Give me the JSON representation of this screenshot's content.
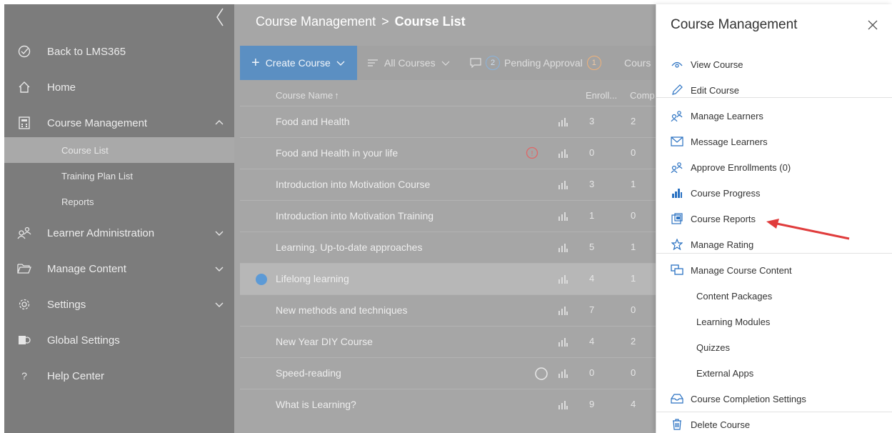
{
  "sidebar": {
    "items": [
      {
        "label": "Back to LMS365",
        "icon": "check-circle-icon"
      },
      {
        "label": "Home",
        "icon": "home-icon"
      },
      {
        "label": "Course Management",
        "icon": "calculator-icon"
      },
      {
        "label": "Learner Administration",
        "icon": "learners-icon"
      },
      {
        "label": "Manage Content",
        "icon": "folder-icon"
      },
      {
        "label": "Settings",
        "icon": "gear-icon"
      },
      {
        "label": "Global Settings",
        "icon": "global-settings-icon"
      },
      {
        "label": "Help Center",
        "icon": "help-icon"
      }
    ],
    "sub_items": [
      "Course List",
      "Training Plan List",
      "Reports"
    ],
    "help_glyph": "?"
  },
  "main": {
    "breadcrumb": {
      "parent": "Course Management",
      "separator": ">",
      "current": "Course List"
    },
    "toolbar": {
      "create_label": "Create Course",
      "plus": "+",
      "filter_label": "All Courses",
      "comment_count": "2",
      "pending_label": "Pending Approval",
      "pending_count": "1",
      "courses_label": "Cours"
    },
    "columns": {
      "name": "Course Name",
      "sort": "↑",
      "enrolled": "Enroll...",
      "completed": "Comp"
    },
    "rows": [
      {
        "name": "Food and Health",
        "enrolled": "3",
        "completed": "2"
      },
      {
        "name": "Food and Health in your life",
        "enrolled": "0",
        "completed": "0",
        "warning": "!"
      },
      {
        "name": "Introduction into Motivation Course",
        "enrolled": "3",
        "completed": "1"
      },
      {
        "name": "Introduction into Motivation Training",
        "enrolled": "1",
        "completed": "0"
      },
      {
        "name": "Learning. Up-to-date approaches",
        "enrolled": "5",
        "completed": "1"
      },
      {
        "name": "Lifelong learning",
        "enrolled": "4",
        "completed": "1"
      },
      {
        "name": "New methods and techniques",
        "enrolled": "7",
        "completed": "0"
      },
      {
        "name": "New Year DIY Course",
        "enrolled": "4",
        "completed": "2"
      },
      {
        "name": "Speed-reading",
        "enrolled": "0",
        "completed": "0"
      },
      {
        "name": "What is Learning?",
        "enrolled": "9",
        "completed": "4"
      }
    ]
  },
  "panel": {
    "title": "Course Management",
    "items": [
      {
        "label": "View Course",
        "icon": "eye-icon"
      },
      {
        "label": "Edit Course",
        "icon": "pencil-icon"
      },
      {
        "label": "Manage Learners",
        "icon": "learners-icon"
      },
      {
        "label": "Message Learners",
        "icon": "mail-icon"
      },
      {
        "label": "Approve Enrollments (0)",
        "icon": "learners-icon"
      },
      {
        "label": "Course Progress",
        "icon": "bar-chart-icon"
      },
      {
        "label": "Course Reports",
        "icon": "report-icon"
      },
      {
        "label": "Manage Rating",
        "icon": "star-icon"
      },
      {
        "label": "Manage Course Content",
        "icon": "content-icon"
      },
      {
        "label": "Content Packages"
      },
      {
        "label": "Learning Modules"
      },
      {
        "label": "Quizzes"
      },
      {
        "label": "External Apps"
      },
      {
        "label": "Course Completion Settings",
        "icon": "inbox-icon"
      },
      {
        "label": "Delete Course",
        "icon": "trash-icon"
      }
    ]
  },
  "colors": {
    "accent": "#5b8fc2",
    "badge": "#f0b27a",
    "warning": "#e06666",
    "arrow": "#e03c3c",
    "panel_icon": "#2b72c2"
  }
}
